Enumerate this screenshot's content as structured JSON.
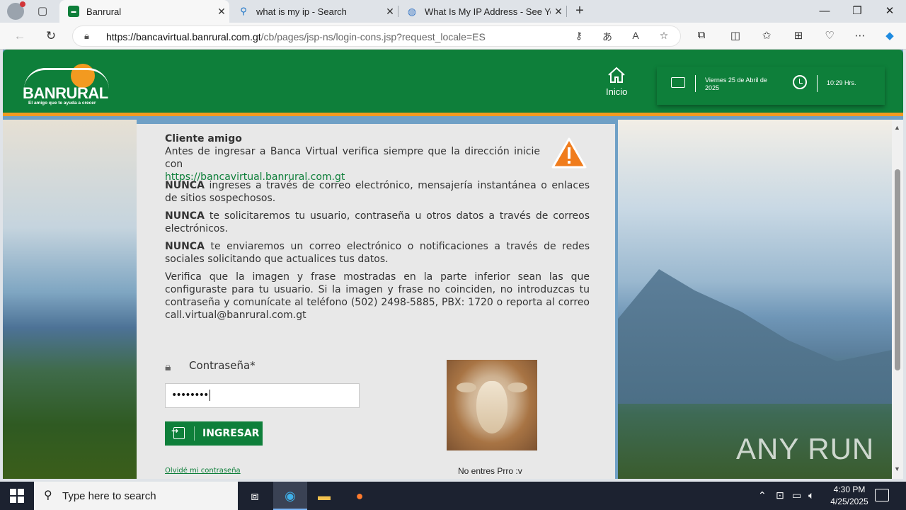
{
  "browser": {
    "tabs": [
      {
        "title": "Banrural",
        "active": true
      },
      {
        "title": "what is my ip - Search",
        "active": false
      },
      {
        "title": "What Is My IP Address - See Your",
        "active": false
      }
    ],
    "url_host": "https://bancavirtual.banrural.com.gt",
    "url_path": "/cb/pages/jsp-ns/login-cons.jsp?request_locale=ES"
  },
  "header": {
    "brand": "BANRURAL",
    "slogan": "El amigo que te ayuda a crecer",
    "home_label": "Inicio",
    "date": "Viernes 25 de Abril de 2025",
    "time": "10:29 Hrs."
  },
  "notice": {
    "title": "Cliente amigo",
    "intro": "Antes de ingresar a Banca Virtual verifica siempre que la dirección inicie con",
    "link": "https://bancavirtual.banrural.com.gt",
    "never_word": "NUNCA",
    "rule1": " ingreses a través de correo electrónico, mensajería instantánea o enlaces de sitios sospechosos.",
    "rule2": " te solicitaremos tu usuario, contraseña u otros datos a través de correos electrónicos.",
    "rule3": " te enviaremos un correo electrónico o notificaciones a través de redes sociales solicitando que actualices tus datos.",
    "verify": "Verifica que la imagen y frase mostradas en la parte inferior sean las que configuraste para tu usuario. Si la imagen y frase no coinciden, no introduzcas tu contraseña y comunícate al teléfono (502) 2498-5885, PBX: 1720 o reporta al correo call.virtual@banrural.com.gt"
  },
  "login": {
    "password_label": "Contraseña*",
    "password_value": "••••••••",
    "submit_label": "INGRESAR",
    "forgot_label": "Olvidé mi contraseña",
    "security_phrase": "No entres Prro :v"
  },
  "watermark": "ANY RUN",
  "taskbar": {
    "search_placeholder": "Type here to search",
    "time": "4:30 PM",
    "date": "4/25/2025"
  },
  "colors": {
    "brand_green": "#0e7f3a",
    "accent_orange": "#f39a20"
  }
}
